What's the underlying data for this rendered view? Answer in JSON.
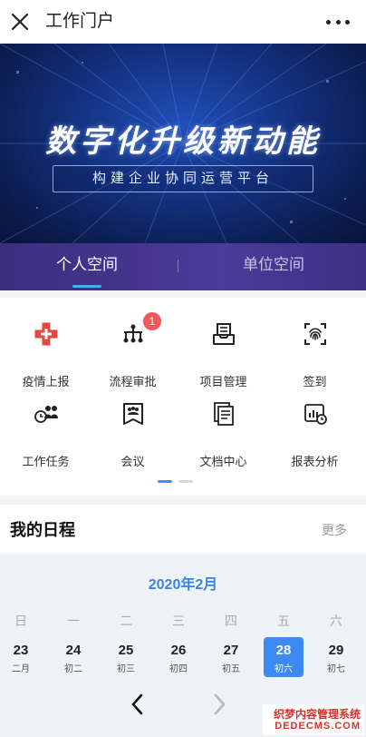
{
  "navbar": {
    "title": "工作门户",
    "close_icon": "close-icon",
    "more_icon": "more-dots-icon"
  },
  "banner": {
    "title": "数字化升级新动能",
    "subtitle": "构建企业协同运营平台"
  },
  "tabs": [
    {
      "label": "个人空间",
      "active": true
    },
    {
      "label": "单位空间",
      "active": false
    }
  ],
  "apps": [
    {
      "label": "疫情上报",
      "icon": "medical-cross-icon",
      "color": "#e8453c"
    },
    {
      "label": "流程审批",
      "icon": "flow-chart-icon",
      "badge": "1"
    },
    {
      "label": "项目管理",
      "icon": "inbox-tray-icon"
    },
    {
      "label": "签到",
      "icon": "fingerprint-scan-icon"
    },
    {
      "label": "工作任务",
      "icon": "team-task-icon"
    },
    {
      "label": "会议",
      "icon": "meeting-icon"
    },
    {
      "label": "文档中心",
      "icon": "document-icon"
    },
    {
      "label": "报表分析",
      "icon": "report-chart-icon"
    }
  ],
  "pager": {
    "pages": 2,
    "current": 1
  },
  "schedule": {
    "title": "我的日程",
    "more_label": "更多",
    "month": "2020年2月",
    "weekdays": [
      "日",
      "一",
      "二",
      "三",
      "四",
      "五",
      "六"
    ],
    "days": [
      {
        "num": "23",
        "lunar": "二月"
      },
      {
        "num": "24",
        "lunar": "初二"
      },
      {
        "num": "25",
        "lunar": "初三"
      },
      {
        "num": "26",
        "lunar": "初四"
      },
      {
        "num": "27",
        "lunar": "初五"
      },
      {
        "num": "28",
        "lunar": "初六",
        "selected": true
      },
      {
        "num": "29",
        "lunar": "初七"
      }
    ]
  },
  "colors": {
    "accent": "#3d8bf2",
    "badge": "#f05a5a",
    "tab_bar": "#45358f"
  },
  "watermark": {
    "line1": "织梦内容管理系统",
    "line2": "DEDECMS.COM"
  }
}
